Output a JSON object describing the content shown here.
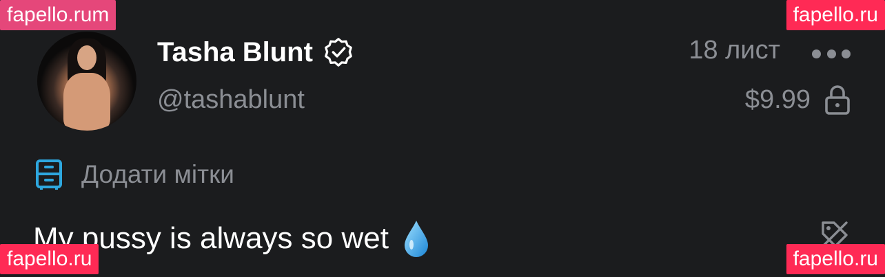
{
  "profile": {
    "name": "Tasha Blunt",
    "handle": "@tashablunt",
    "avatar_icon": "avatar-photo"
  },
  "post": {
    "date": "18 лист",
    "price": "$9.99",
    "tags_label": "Додати мітки",
    "caption": "My pussy is always so wet"
  },
  "icons": {
    "verified": "verified-badge-icon",
    "more": "more-dots-icon",
    "lock": "lock-icon",
    "tag": "tag-icon",
    "droplet": "droplet-emoji-icon",
    "no_tag": "no-tag-icon"
  },
  "watermarks": {
    "top_left": "fapello.rum",
    "top_right": "fapello.ru",
    "bottom_left": "fapello.ru",
    "bottom_right": "fapello.ru"
  },
  "colors": {
    "background": "#1b1c1e",
    "primary_text": "#ffffff",
    "secondary_text": "#8b8e94",
    "accent": "#2ea8e0",
    "watermark": "#ff2a55"
  }
}
